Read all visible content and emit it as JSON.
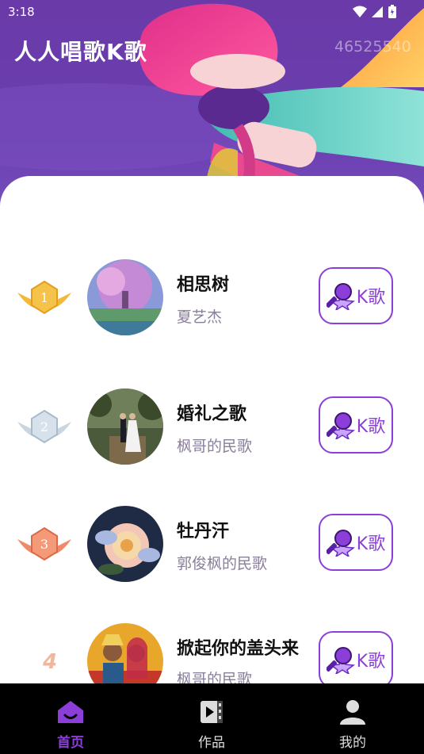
{
  "status_bar": {
    "time": "3:18"
  },
  "header": {
    "title": "人人唱歌K歌",
    "user_id": "46525540"
  },
  "songs": [
    {
      "rank": "1",
      "title": "相思树",
      "artist": "夏艺杰",
      "button_label": "K歌"
    },
    {
      "rank": "2",
      "title": "婚礼之歌",
      "artist": "枫哥的民歌",
      "button_label": "K歌"
    },
    {
      "rank": "3",
      "title": "牡丹汗",
      "artist": "郭俊枫的民歌",
      "button_label": "K歌"
    },
    {
      "rank": "4",
      "title": "掀起你的盖头来",
      "artist": "枫哥的民歌",
      "button_label": "K歌"
    }
  ],
  "nav": {
    "items": [
      {
        "label": "首页",
        "icon": "home-icon",
        "active": true
      },
      {
        "label": "作品",
        "icon": "video-icon",
        "active": false
      },
      {
        "label": "我的",
        "icon": "profile-icon",
        "active": false
      }
    ]
  },
  "colors": {
    "accent": "#8b3ed8",
    "header": "#6a3aa8"
  }
}
